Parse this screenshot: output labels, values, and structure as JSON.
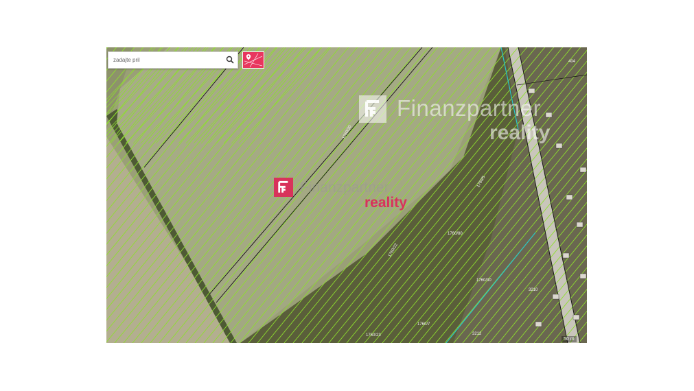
{
  "search": {
    "placeholder": "zadajte pril"
  },
  "watermark": {
    "brand": "Finanzpartner",
    "sub": "reality"
  },
  "colors": {
    "accent": "#e8365e",
    "parcel_line": "#8ee02e",
    "boundary_line": "#111111",
    "road_line": "#29c6c9"
  },
  "parcel_labels": [
    "1760/20",
    "1760/22",
    "1760/80",
    "1760/5",
    "1760/30",
    "1760/7",
    "1760/23",
    "404",
    "3210",
    "3212"
  ],
  "map_footer": {
    "scale": "50 m"
  }
}
